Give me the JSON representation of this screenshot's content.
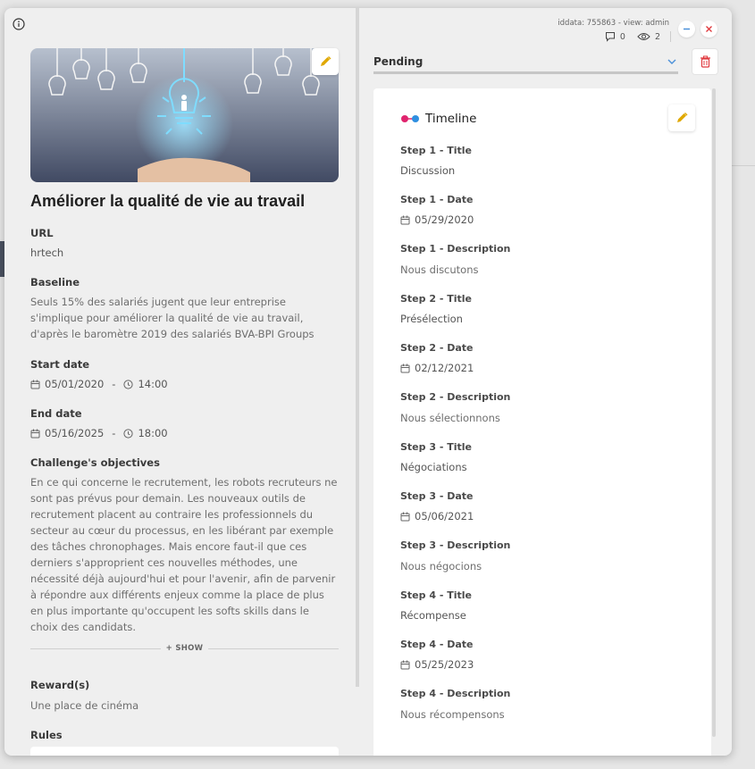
{
  "header": {
    "meta": "iddata: 755863 - view: admin",
    "comments_count": "0",
    "views_count": "2"
  },
  "challenge": {
    "title": "Améliorer la qualité de vie au travail",
    "url_label": "URL",
    "url_value": "hrtech",
    "baseline_label": "Baseline",
    "baseline_text": "Seuls 15% des salariés jugent que leur entreprise s'implique pour améliorer la qualité de vie au travail, d'après le baromètre 2019 des salariés BVA-BPI Groups",
    "start_label": "Start date",
    "start_date": "05/01/2020",
    "start_time": "14:00",
    "end_label": "End date",
    "end_date": "05/16/2025",
    "end_time": "18:00",
    "dash": "-",
    "objectives_label": "Challenge's objectives",
    "objectives_text": "En ce qui concerne le recrutement, les robots recruteurs ne sont pas prévus pour demain. Les nouveaux outils de recrutement placent au contraire les professionnels du secteur au cœur du processus, en les libérant par exemple des tâches chronophages. Mais encore faut-il que ces derniers s'approprient ces nouvelles méthodes, une nécessité déjà aujourd'hui et pour l'avenir, afin de parvenir à répondre aux différents enjeux comme la place de plus en plus importante qu'occupent les softs skills dans le choix des candidats.",
    "show_label": "+ SHOW",
    "reward_label": "Reward(s)",
    "reward_value": "Une place de cinéma",
    "rules_label": "Rules"
  },
  "status": {
    "selected": "Pending"
  },
  "timeline": {
    "title": "Timeline",
    "steps": [
      {
        "title_label": "Step 1 - Title",
        "title": "Discussion",
        "date_label": "Step 1 - Date",
        "date": "05/29/2020",
        "desc_label": "Step 1 - Description",
        "desc": "Nous discutons"
      },
      {
        "title_label": "Step 2 - Title",
        "title": "Présélection",
        "date_label": "Step 2 - Date",
        "date": "02/12/2021",
        "desc_label": "Step 2 - Description",
        "desc": "Nous sélectionnons"
      },
      {
        "title_label": "Step 3 - Title",
        "title": "Négociations",
        "date_label": "Step 3 - Date",
        "date": "05/06/2021",
        "desc_label": "Step 3 - Description",
        "desc": "Nous négocions"
      },
      {
        "title_label": "Step 4 - Title",
        "title": "Récompense",
        "date_label": "Step 4 - Date",
        "date": "05/25/2023",
        "desc_label": "Step 4 - Description",
        "desc": "Nous récompensons"
      }
    ]
  },
  "colors": {
    "edit_accent": "#e0a800",
    "delete_accent": "#e0393e",
    "minimize_accent": "#4a90d9",
    "timeline_dot_pink": "#e0246e",
    "timeline_dot_blue": "#2f8fe0"
  }
}
